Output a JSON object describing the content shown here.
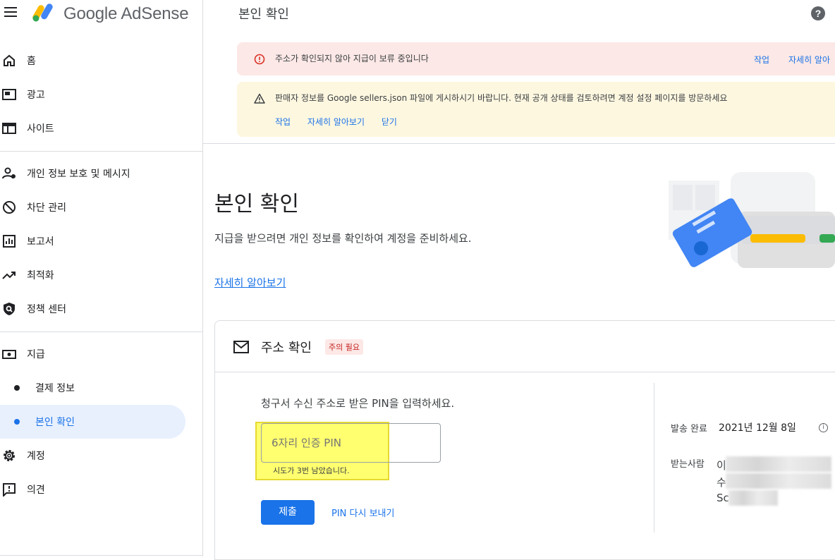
{
  "header": {
    "brand": "Google AdSense",
    "page_title": "본인 확인",
    "help": "?"
  },
  "sidebar": {
    "items": [
      {
        "label": "홈",
        "icon": "home-icon"
      },
      {
        "label": "광고",
        "icon": "ads-icon"
      },
      {
        "label": "사이트",
        "icon": "sites-icon"
      },
      {
        "label": "개인 정보 보호 및 메시지",
        "icon": "privacy-icon"
      },
      {
        "label": "차단 관리",
        "icon": "block-icon"
      },
      {
        "label": "보고서",
        "icon": "reports-icon"
      },
      {
        "label": "최적화",
        "icon": "optimization-icon"
      },
      {
        "label": "정책 센터",
        "icon": "policy-icon"
      },
      {
        "label": "지급",
        "icon": "payments-icon"
      },
      {
        "label": "결제 정보"
      },
      {
        "label": "본인 확인"
      },
      {
        "label": "계정",
        "icon": "gear-icon"
      },
      {
        "label": "의견",
        "icon": "feedback-icon"
      }
    ]
  },
  "banners": {
    "error": {
      "text": "주소가 확인되지 않아 지급이 보류 중입니다",
      "action": "작업",
      "learn": "자세히 알아"
    },
    "warning": {
      "text": "판매자 정보를 Google sellers.json 파일에 게시하시기 바랍니다. 현재 공개 상태를 검토하려면 계정 설정 페이지를 방문하세요",
      "action": "작업",
      "learn": "자세히 알아보기",
      "dismiss": "닫기"
    }
  },
  "main": {
    "title": "본인 확인",
    "description": "지급을 받으려면 개인 정보를 확인하여 계정을 준비하세요.",
    "learn_more": "자세히 알아보기"
  },
  "address_card": {
    "title": "주소 확인",
    "badge": "주의 필요",
    "instruction": "청구서 수신 주소로 받은 PIN을 입력하세요.",
    "pin_placeholder": "6자리 인증 PIN",
    "helper": "시도가 3번 남았습니다.",
    "submit": "제출",
    "resend": "PIN 다시 보내기",
    "sent_label": "발송 완료",
    "sent_date": "2021년 12월 8일",
    "info": "i",
    "recipient_label": "받는사람",
    "recipient_lines": [
      "이",
      "수",
      "Sc"
    ]
  },
  "colors": {
    "accent": "#1a73e8",
    "error_bg": "#fce8e6",
    "warn_bg": "#fef7e0",
    "highlight": "#ffff4c"
  }
}
